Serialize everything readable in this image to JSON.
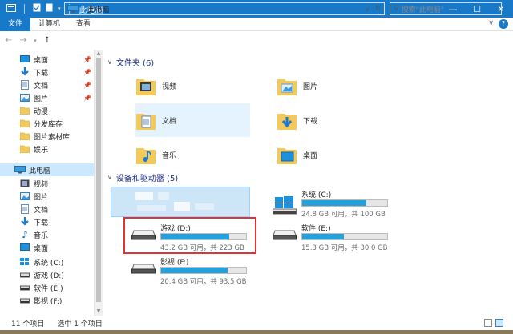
{
  "titlebar": {
    "title": "此电脑"
  },
  "ribbon": {
    "tabs": [
      "文件",
      "计算机",
      "查看"
    ]
  },
  "address": {
    "path": "此电脑",
    "search_placeholder": "搜索\"此电脑\""
  },
  "sidebar": {
    "items": [
      {
        "label": "桌面",
        "icon": "desktop-icon",
        "pinned": true
      },
      {
        "label": "下载",
        "icon": "download-icon",
        "pinned": true
      },
      {
        "label": "文档",
        "icon": "document-icon",
        "pinned": true
      },
      {
        "label": "图片",
        "icon": "picture-icon",
        "pinned": true
      },
      {
        "label": "动漫",
        "icon": "folder-icon"
      },
      {
        "label": "分发库存",
        "icon": "folder-icon"
      },
      {
        "label": "图片素材库",
        "icon": "folder-icon"
      },
      {
        "label": "娱乐",
        "icon": "folder-icon"
      },
      {
        "label": "此电脑",
        "icon": "pc-icon",
        "selected": true
      },
      {
        "label": "视频",
        "icon": "video-icon"
      },
      {
        "label": "图片",
        "icon": "picture-icon"
      },
      {
        "label": "文档",
        "icon": "document-icon"
      },
      {
        "label": "下载",
        "icon": "download-icon"
      },
      {
        "label": "音乐",
        "icon": "music-icon"
      },
      {
        "label": "桌面",
        "icon": "desktop-icon"
      },
      {
        "label": "系统 (C:)",
        "icon": "drive-icon"
      },
      {
        "label": "游戏 (D:)",
        "icon": "drive-icon"
      },
      {
        "label": "软件 (E:)",
        "icon": "drive-icon"
      },
      {
        "label": "影视 (F:)",
        "icon": "drive-icon"
      }
    ]
  },
  "folders_group": {
    "title": "文件夹 (6)"
  },
  "folders": [
    {
      "name": "视频",
      "icon": "video-folder-icon"
    },
    {
      "name": "图片",
      "icon": "picture-folder-icon"
    },
    {
      "name": "文档",
      "icon": "document-folder-icon"
    },
    {
      "name": "下载",
      "icon": "download-folder-icon"
    },
    {
      "name": "音乐",
      "icon": "music-folder-icon"
    },
    {
      "name": "桌面",
      "icon": "desktop-folder-icon"
    }
  ],
  "drives_group": {
    "title": "设备和驱动器 (5)"
  },
  "drives": [
    {
      "name": "系统 (C:)",
      "info": "24.8 GB 可用，共 100 GB",
      "used_fraction": 0.752
    },
    {
      "name": "游戏 (D:)",
      "info": "43.2 GB 可用，共 223 GB",
      "used_fraction": 0.806
    },
    {
      "name": "软件 (E:)",
      "info": "15.3 GB 可用，共 30.0 GB",
      "used_fraction": 0.49
    },
    {
      "name": "影视 (F:)",
      "info": "20.4 GB 可用，共 93.5 GB",
      "used_fraction": 0.782
    }
  ],
  "status": {
    "count": "11 个项目",
    "selected": "选中 1 个项目"
  },
  "colors": {
    "accent": "#1979c9",
    "bar_fill": "#26a0da",
    "highlight": "#e03333"
  }
}
